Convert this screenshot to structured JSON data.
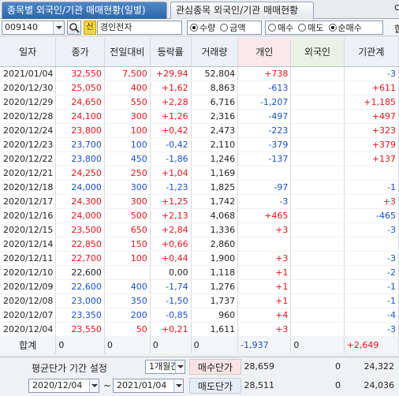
{
  "tabs": [
    {
      "label": "종목별 외국인/기관 매매현황(일별)",
      "active": true
    },
    {
      "label": "관심종목 외국인/기관 매매현황",
      "active": false
    }
  ],
  "tab_end_char": "c",
  "toolbar": {
    "code": "009140",
    "badge": "신",
    "stock_name": "경인전자",
    "unit_options": [
      {
        "label": "수량",
        "selected": true
      },
      {
        "label": "금액",
        "selected": false
      }
    ],
    "trade_options": [
      {
        "label": "매수",
        "selected": false
      },
      {
        "label": "매도",
        "selected": false
      },
      {
        "label": "순매수",
        "selected": true
      }
    ],
    "end_char": "합"
  },
  "table": {
    "columns": [
      "일자",
      "종가",
      "전일대비",
      "등락률",
      "거래량",
      "개인",
      "외국인",
      "기관계"
    ],
    "rows": [
      {
        "date": "2021/01/04",
        "close": "32,550",
        "change": "7,500",
        "rate": "+29,94",
        "volume": "52,804",
        "indiv": "+738",
        "foreign": "",
        "inst": "-3",
        "dir": "pos"
      },
      {
        "date": "2020/12/30",
        "close": "25,050",
        "change": "400",
        "rate": "+1,62",
        "volume": "8,863",
        "indiv": "-613",
        "foreign": "",
        "inst": "+611",
        "dir": "pos"
      },
      {
        "date": "2020/12/29",
        "close": "24,650",
        "change": "550",
        "rate": "+2,28",
        "volume": "6,716",
        "indiv": "-1,207",
        "foreign": "",
        "inst": "+1,185",
        "dir": "pos"
      },
      {
        "date": "2020/12/28",
        "close": "24,100",
        "change": "300",
        "rate": "+1,26",
        "volume": "2,316",
        "indiv": "-497",
        "foreign": "",
        "inst": "+497",
        "dir": "pos"
      },
      {
        "date": "2020/12/24",
        "close": "23,800",
        "change": "100",
        "rate": "+0,42",
        "volume": "2,473",
        "indiv": "-223",
        "foreign": "",
        "inst": "+323",
        "dir": "pos"
      },
      {
        "date": "2020/12/23",
        "close": "23,700",
        "change": "100",
        "rate": "-0,42",
        "volume": "2,110",
        "indiv": "-379",
        "foreign": "",
        "inst": "+379",
        "dir": "neg"
      },
      {
        "date": "2020/12/22",
        "close": "23,800",
        "change": "450",
        "rate": "-1,86",
        "volume": "1,246",
        "indiv": "-137",
        "foreign": "",
        "inst": "+137",
        "dir": "neg"
      },
      {
        "date": "2020/12/21",
        "close": "24,250",
        "change": "250",
        "rate": "+1,04",
        "volume": "1,169",
        "indiv": "",
        "foreign": "",
        "inst": "",
        "dir": "pos"
      },
      {
        "date": "2020/12/18",
        "close": "24,000",
        "change": "300",
        "rate": "-1,23",
        "volume": "1,825",
        "indiv": "-97",
        "foreign": "",
        "inst": "-1",
        "dir": "neg"
      },
      {
        "date": "2020/12/17",
        "close": "24,300",
        "change": "300",
        "rate": "+1,25",
        "volume": "1,742",
        "indiv": "-3",
        "foreign": "",
        "inst": "+3",
        "dir": "pos"
      },
      {
        "date": "2020/12/16",
        "close": "24,000",
        "change": "500",
        "rate": "+2,13",
        "volume": "4,068",
        "indiv": "+465",
        "foreign": "",
        "inst": "-465",
        "dir": "pos"
      },
      {
        "date": "2020/12/15",
        "close": "23,500",
        "change": "650",
        "rate": "+2,84",
        "volume": "1,336",
        "indiv": "+3",
        "foreign": "",
        "inst": "-3",
        "dir": "pos"
      },
      {
        "date": "2020/12/14",
        "close": "22,850",
        "change": "150",
        "rate": "+0,66",
        "volume": "2,860",
        "indiv": "",
        "foreign": "",
        "inst": "",
        "dir": "pos"
      },
      {
        "date": "2020/12/11",
        "close": "22,700",
        "change": "100",
        "rate": "+0,44",
        "volume": "1,900",
        "indiv": "+3",
        "foreign": "",
        "inst": "-3",
        "dir": "pos"
      },
      {
        "date": "2020/12/10",
        "close": "22,600",
        "change": "",
        "rate": "0,00",
        "volume": "1,118",
        "indiv": "+1",
        "foreign": "",
        "inst": "-2",
        "dir": "flat"
      },
      {
        "date": "2020/12/09",
        "close": "22,600",
        "change": "400",
        "rate": "-1,74",
        "volume": "1,276",
        "indiv": "+1",
        "foreign": "",
        "inst": "-1",
        "dir": "neg"
      },
      {
        "date": "2020/12/08",
        "close": "23,000",
        "change": "350",
        "rate": "-1,50",
        "volume": "1,737",
        "indiv": "+1",
        "foreign": "",
        "inst": "-1",
        "dir": "neg"
      },
      {
        "date": "2020/12/07",
        "close": "23,350",
        "change": "200",
        "rate": "-0,85",
        "volume": "960",
        "indiv": "+4",
        "foreign": "",
        "inst": "-4",
        "dir": "neg"
      },
      {
        "date": "2020/12/04",
        "close": "23,550",
        "change": "50",
        "rate": "+0,21",
        "volume": "1,611",
        "indiv": "+3",
        "foreign": "",
        "inst": "-3",
        "dir": "pos"
      }
    ],
    "total": {
      "label": "합계",
      "close": "0",
      "change": "0",
      "rate": "0",
      "volume": "0",
      "indiv": "-1,937",
      "foreign": "0",
      "inst": "+2,649"
    }
  },
  "bottom": {
    "period_label": "평균단가 기간 설정",
    "period_value": "1개월간",
    "start_date": "2020/12/04",
    "tilde": "~",
    "end_date": "2021/01/04",
    "buy_label": "매수단가",
    "buy_values": [
      "28,659",
      "0",
      "24,322"
    ],
    "sell_label": "매도단가",
    "sell_values": [
      "28,511",
      "0",
      "24,036"
    ]
  },
  "colors": {
    "up": "#e8131b",
    "down": "#1a4fd0",
    "tab_active": "#3a72b8"
  }
}
